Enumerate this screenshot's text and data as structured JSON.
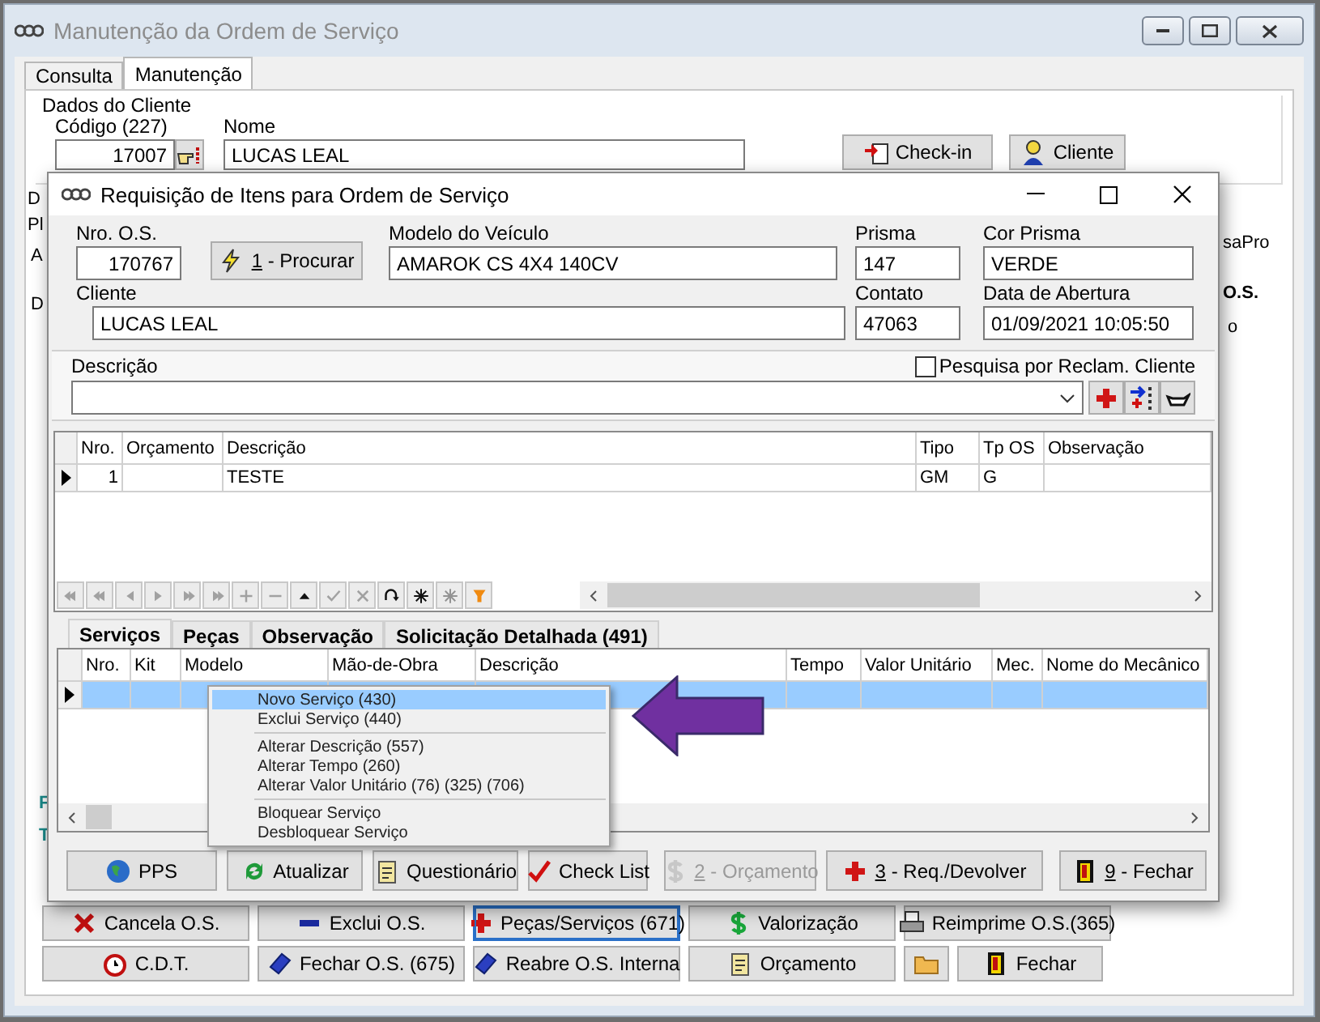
{
  "main_window": {
    "title": "Manutenção da Ordem de Serviço",
    "tabs": [
      {
        "label": "Consulta",
        "selected": false
      },
      {
        "label": "Manutenção",
        "selected": true
      }
    ],
    "client_group": {
      "title": "Dados do Cliente",
      "code_label": "Código (227)",
      "code": "17007",
      "name_label": "Nome",
      "name": "LUCAS LEAL"
    },
    "header_buttons": [
      {
        "label": "Check-in"
      },
      {
        "label": "Cliente"
      }
    ],
    "left_fragments": [
      {
        "text": "D",
        "kind": "label"
      },
      {
        "text": "Pl",
        "kind": "label"
      },
      {
        "text": "A",
        "kind": "field"
      },
      {
        "text": "D",
        "kind": "tab"
      },
      {
        "text": "F",
        "kind": "accent"
      },
      {
        "text": "T",
        "kind": "accent"
      }
    ],
    "right_fragments": [
      {
        "text": "saPro",
        "kind": "button"
      },
      {
        "text": "O.S.",
        "kind": "tab"
      },
      {
        "text": "o",
        "kind": "label"
      }
    ],
    "action_rows": [
      [
        {
          "label": "Cancela O.S.",
          "focused": false
        },
        {
          "label": "Exclui O.S.",
          "focused": false
        },
        {
          "label": "Peças/Serviços (671)",
          "focused": true
        },
        {
          "label": "Valorização",
          "focused": false
        },
        {
          "label": "Reimprime O.S.(365)",
          "focused": false
        }
      ],
      [
        {
          "label": "C.D.T.",
          "focused": false
        },
        {
          "label": "Fechar O.S. (675)",
          "focused": false
        },
        {
          "label": "Reabre O.S. Interna",
          "focused": false
        },
        {
          "label": "Orçamento",
          "focused": false
        },
        {
          "focused": false
        },
        {
          "label": "Fechar",
          "focused": false
        }
      ]
    ]
  },
  "dialog": {
    "title": "Requisição de Itens para Ordem de Serviço",
    "os_label": "Nro. O.S.",
    "os_number": "170767",
    "search_button": {
      "key": "1",
      "label": "- Procurar"
    },
    "model_label": "Modelo do Veículo",
    "model": "AMAROK CS 4X4 140CV",
    "prism_label": "Prisma",
    "prism": "147",
    "prism_color_label": "Cor Prisma",
    "prism_color": "VERDE",
    "client_label": "Cliente",
    "client": "LUCAS LEAL",
    "contact_label": "Contato",
    "contact": "47063",
    "opened_label": "Data de Abertura",
    "opened": "01/09/2021 10:05:50",
    "description_label": "Descrição",
    "complaint_search": {
      "label": "Pesquisa por Reclam. Cliente",
      "checked": false
    },
    "items_table": {
      "columns": [
        "Nro.",
        "Orçamento",
        "Descrição",
        "Tipo",
        "Tp OS",
        "Observação"
      ],
      "rows": [
        {
          "current": true,
          "cells": [
            "1",
            null,
            "TESTE",
            "GM",
            "G",
            null
          ]
        }
      ]
    },
    "navigator": [
      {
        "disabled": true
      },
      {
        "disabled": true
      },
      {
        "disabled": true
      },
      {
        "disabled": true
      },
      {
        "disabled": true
      },
      {
        "disabled": true
      },
      {
        "disabled": true
      },
      {
        "disabled": true
      },
      {
        "disabled": false
      },
      {
        "disabled": true
      },
      {
        "disabled": true
      },
      {
        "disabled": false
      },
      {
        "disabled": false
      },
      {
        "disabled": true
      },
      {
        "disabled": false
      }
    ],
    "detail_tabs": [
      {
        "label": "Serviços",
        "selected": true
      },
      {
        "label": "Peças",
        "selected": false
      },
      {
        "label": "Observação",
        "selected": false
      },
      {
        "label": "Solicitação Detalhada (491)",
        "selected": false
      }
    ],
    "services_table": {
      "columns": [
        "Nro.",
        "Kit",
        "Modelo",
        "Mão-de-Obra",
        "Descrição",
        "Tempo",
        "Valor Unitário",
        "Mec.",
        "Nome do Mecânico"
      ],
      "rows": [
        {
          "selected": true
        }
      ]
    },
    "context_menu": [
      [
        {
          "label": "Novo Serviço (430)",
          "selected": true
        },
        {
          "label": "Exclui Serviço (440)",
          "selected": false
        }
      ],
      [
        {
          "label": "Alterar Descrição (557)",
          "selected": false
        },
        {
          "label": "Alterar Tempo (260)",
          "selected": false
        },
        {
          "label": "Alterar Valor Unitário (76) (325) (706)",
          "selected": false
        }
      ],
      [
        {
          "label": "Bloquear Serviço",
          "selected": false
        },
        {
          "label": "Desbloquear Serviço",
          "selected": false
        }
      ]
    ],
    "buttons": [
      {
        "label": "PPS",
        "disabled": false
      },
      {
        "label": "Atualizar",
        "disabled": false
      },
      {
        "label": "Questionário",
        "disabled": false
      },
      {
        "label": "Check List",
        "disabled": false
      },
      {
        "key": "2",
        "label": "- Orçamento",
        "disabled": true
      },
      {
        "key": "3",
        "label": "- Req./Devolver",
        "disabled": false
      },
      {
        "key": "9",
        "label": "- Fechar",
        "disabled": false
      }
    ]
  }
}
